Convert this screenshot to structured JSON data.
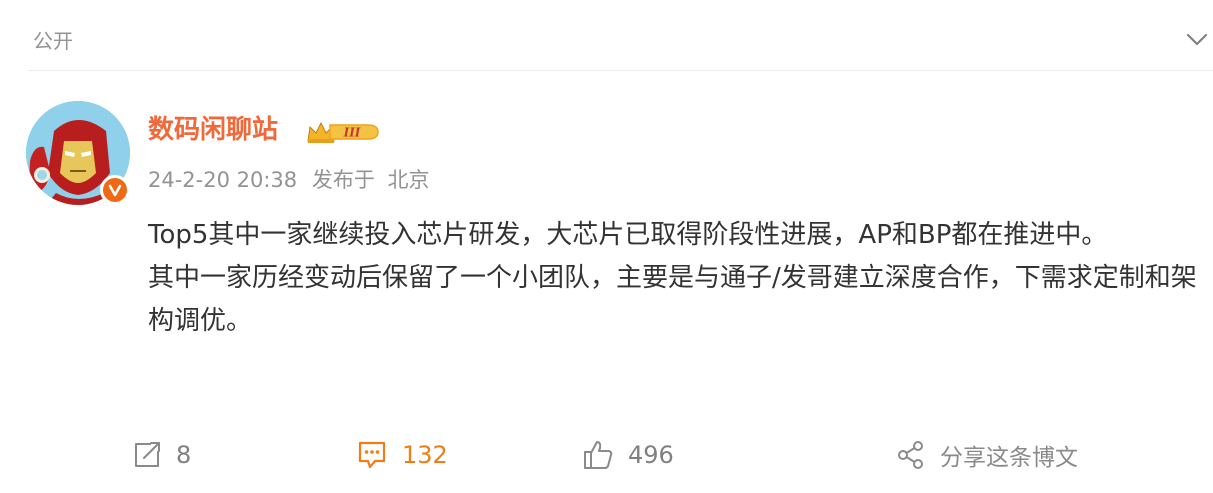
{
  "visibility": {
    "label": "公开"
  },
  "post": {
    "author": "数码闲聊站",
    "vip_level": "III",
    "timestamp": "24-2-20 20:38",
    "location_prefix": "发布于",
    "location": "北京",
    "paragraphs": [
      "Top5其中一家继续投入芯片研发，大芯片已取得阶段性进展，AP和BP都在推进中。",
      "其中一家历经变动后保留了一个小团队，主要是与通子/发哥建立深度合作，下需求定制和架构调优。"
    ]
  },
  "actions": {
    "reposts": "8",
    "comments": "132",
    "likes": "496",
    "share_label": "分享这条博文"
  },
  "colors": {
    "author": "#f0693a",
    "comment_accent": "#f07d16",
    "muted": "#939393",
    "verified": "#f06a16"
  },
  "icons": {
    "visibility": "chevron-down-icon",
    "repost": "repost-icon",
    "comment": "comment-icon",
    "like": "thumbs-up-icon",
    "share": "share-icon"
  }
}
